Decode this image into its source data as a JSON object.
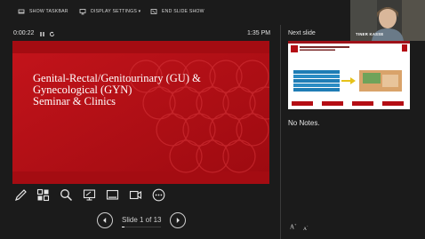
{
  "toolbar": {
    "show_taskbar": "SHOW TASKBAR",
    "display_settings": "DISPLAY SETTINGS ▾",
    "end_slide_show": "END SLIDE SHOW"
  },
  "timer": {
    "elapsed": "0:00:22",
    "clock": "1:35 PM"
  },
  "current_slide": {
    "title_line1": "Genital-Rectal/Genitourinary (GU) &",
    "title_line2": "Gynecological (GYN)",
    "title_line3": "Seminar & Clinics"
  },
  "next_slide": {
    "label": "Next slide"
  },
  "notes": {
    "text": "No Notes."
  },
  "webcam": {
    "name": "TINER KASSE"
  },
  "navigation": {
    "counter": "Slide 1 of 13",
    "progress_fraction": 0.077
  },
  "font_controls": {
    "increase": "A",
    "decrease": "A"
  },
  "colors": {
    "slide_red": "#b40d14",
    "background": "#1b1b1b"
  }
}
